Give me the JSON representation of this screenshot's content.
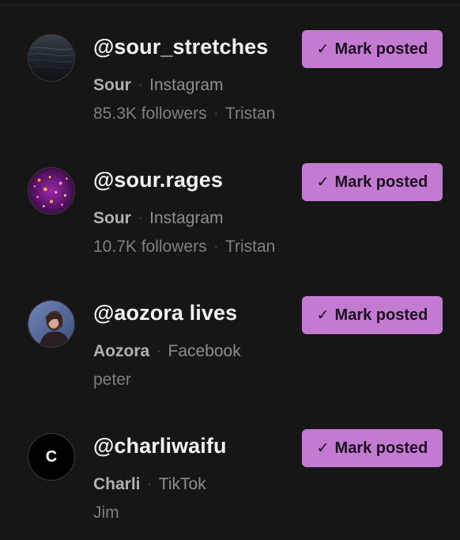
{
  "accounts": [
    {
      "handle": "@sour_stretches",
      "brand": "Sour",
      "platform": "Instagram",
      "followers": "85.3K followers",
      "owner": "Tristan",
      "avatar_icon": "water-photo-avatar",
      "button_label": "Mark posted"
    },
    {
      "handle": "@sour.rages",
      "brand": "Sour",
      "platform": "Instagram",
      "followers": "10.7K followers",
      "owner": "Tristan",
      "avatar_icon": "glitter-photo-avatar",
      "button_label": "Mark posted"
    },
    {
      "handle": "@aozora lives",
      "brand": "Aozora",
      "platform": "Facebook",
      "owner": "peter",
      "avatar_icon": "person-photo-avatar",
      "button_label": "Mark posted"
    },
    {
      "handle": "@charliwaifu",
      "brand": "Charli",
      "platform": "TikTok",
      "owner": "Jim",
      "avatar_letter": "C",
      "avatar_icon": "letter-avatar",
      "button_label": "Mark posted"
    }
  ],
  "button_check_icon": "checkmark-icon",
  "colors": {
    "background": "#161616",
    "accent": "#c27bd0",
    "handle_text": "#f2f2f2",
    "muted_text": "#8e8e8e"
  }
}
